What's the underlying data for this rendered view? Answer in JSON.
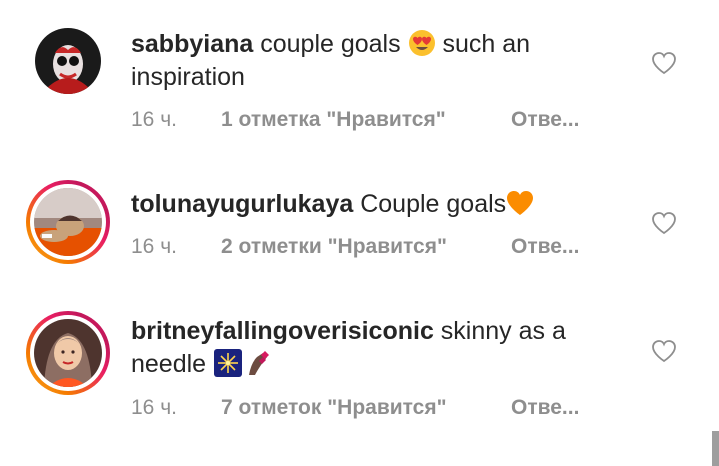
{
  "comments": [
    {
      "username": "sabbyiana",
      "text_before_emoji": " couple goals ",
      "emoji": "heart-eyes-emoji",
      "text_after_emoji": " such an inspiration",
      "time": "16 ч.",
      "likes": "1 отметка \"Нравится\"",
      "reply": "Отве..."
    },
    {
      "username": "tolunayugurlukaya",
      "text_before_emoji": " Couple goals",
      "emoji": "orange-heart-emoji",
      "text_after_emoji": "",
      "time": "16 ч.",
      "likes": "2 отметки \"Нравится\"",
      "reply": "Отве..."
    },
    {
      "username": "britneyfallingoverisiconic",
      "text_before_emoji": " skinny as a needle ",
      "emoji": "fireworks-and-nail-polish-emoji",
      "text_after_emoji": "",
      "time": "16 ч.",
      "likes": "7 отметок \"Нравится\"",
      "reply": "Отве..."
    }
  ],
  "icons": {
    "like": "heart-outline-icon"
  },
  "colors": {
    "text": "#262626",
    "meta": "#8e8e8e",
    "story_ring_start": "#f9a825",
    "story_ring_end": "#d81b60"
  }
}
